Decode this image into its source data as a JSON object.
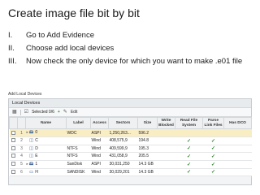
{
  "slide": {
    "title": "Create image file bit by bit",
    "steps": [
      {
        "num": "I.",
        "text": "Go to Add Evidence"
      },
      {
        "num": "II.",
        "text": "Choose add local devices"
      },
      {
        "num": "III.",
        "text": "Now check the only device for which you want to make .e01 file"
      }
    ]
  },
  "dialog": {
    "title": "Add Local Devices",
    "panel_title": "Local Devices",
    "toolbar": {
      "selected_label": "Selected 0/6",
      "add_icon": "plus-icon",
      "edit_label": "Edit"
    },
    "columns": [
      "Name",
      "Label",
      "Access",
      "Sectors",
      "Size",
      "Write Blocked",
      "Read File System",
      "Parse Link Files",
      "Has DCO"
    ],
    "rows": [
      {
        "index": "1",
        "name": "0",
        "label": "WDC",
        "access": "ASPI",
        "sectors": "1,250,263...",
        "size": "596.2",
        "read_fs": false,
        "parse_link": false,
        "icon": "hard-drive-icon",
        "selected": true
      },
      {
        "index": "2",
        "name": "C",
        "label": "",
        "access": "Wind",
        "sectors": "408,575,9",
        "size": "194.8",
        "read_fs": true,
        "parse_link": true,
        "icon": "partition-icon",
        "selected": false
      },
      {
        "index": "3",
        "name": "D",
        "label": "NTFS",
        "access": "Wind",
        "sectors": "409,599,9",
        "size": "195.3",
        "read_fs": true,
        "parse_link": true,
        "icon": "partition-icon",
        "selected": false
      },
      {
        "index": "4",
        "name": "E",
        "label": "NTFS",
        "access": "Wind",
        "sectors": "431,058,9",
        "size": "205.5",
        "read_fs": true,
        "parse_link": true,
        "icon": "partition-icon",
        "selected": false
      },
      {
        "index": "5",
        "name": "1",
        "label": "SanDisk",
        "access": "ASPI",
        "sectors": "30,031,250",
        "size": "14.3 GB",
        "read_fs": true,
        "parse_link": true,
        "icon": "hard-drive-icon",
        "selected": false
      },
      {
        "index": "6",
        "name": "H",
        "label": "SANDISK",
        "access": "Wind",
        "sectors": "30,029,201",
        "size": "14.3 GB",
        "read_fs": true,
        "parse_link": true,
        "icon": "usb-drive-icon",
        "selected": false
      }
    ],
    "colors": {
      "selected_row": "#f9edc4",
      "check_green": "#2b7d2b"
    }
  }
}
